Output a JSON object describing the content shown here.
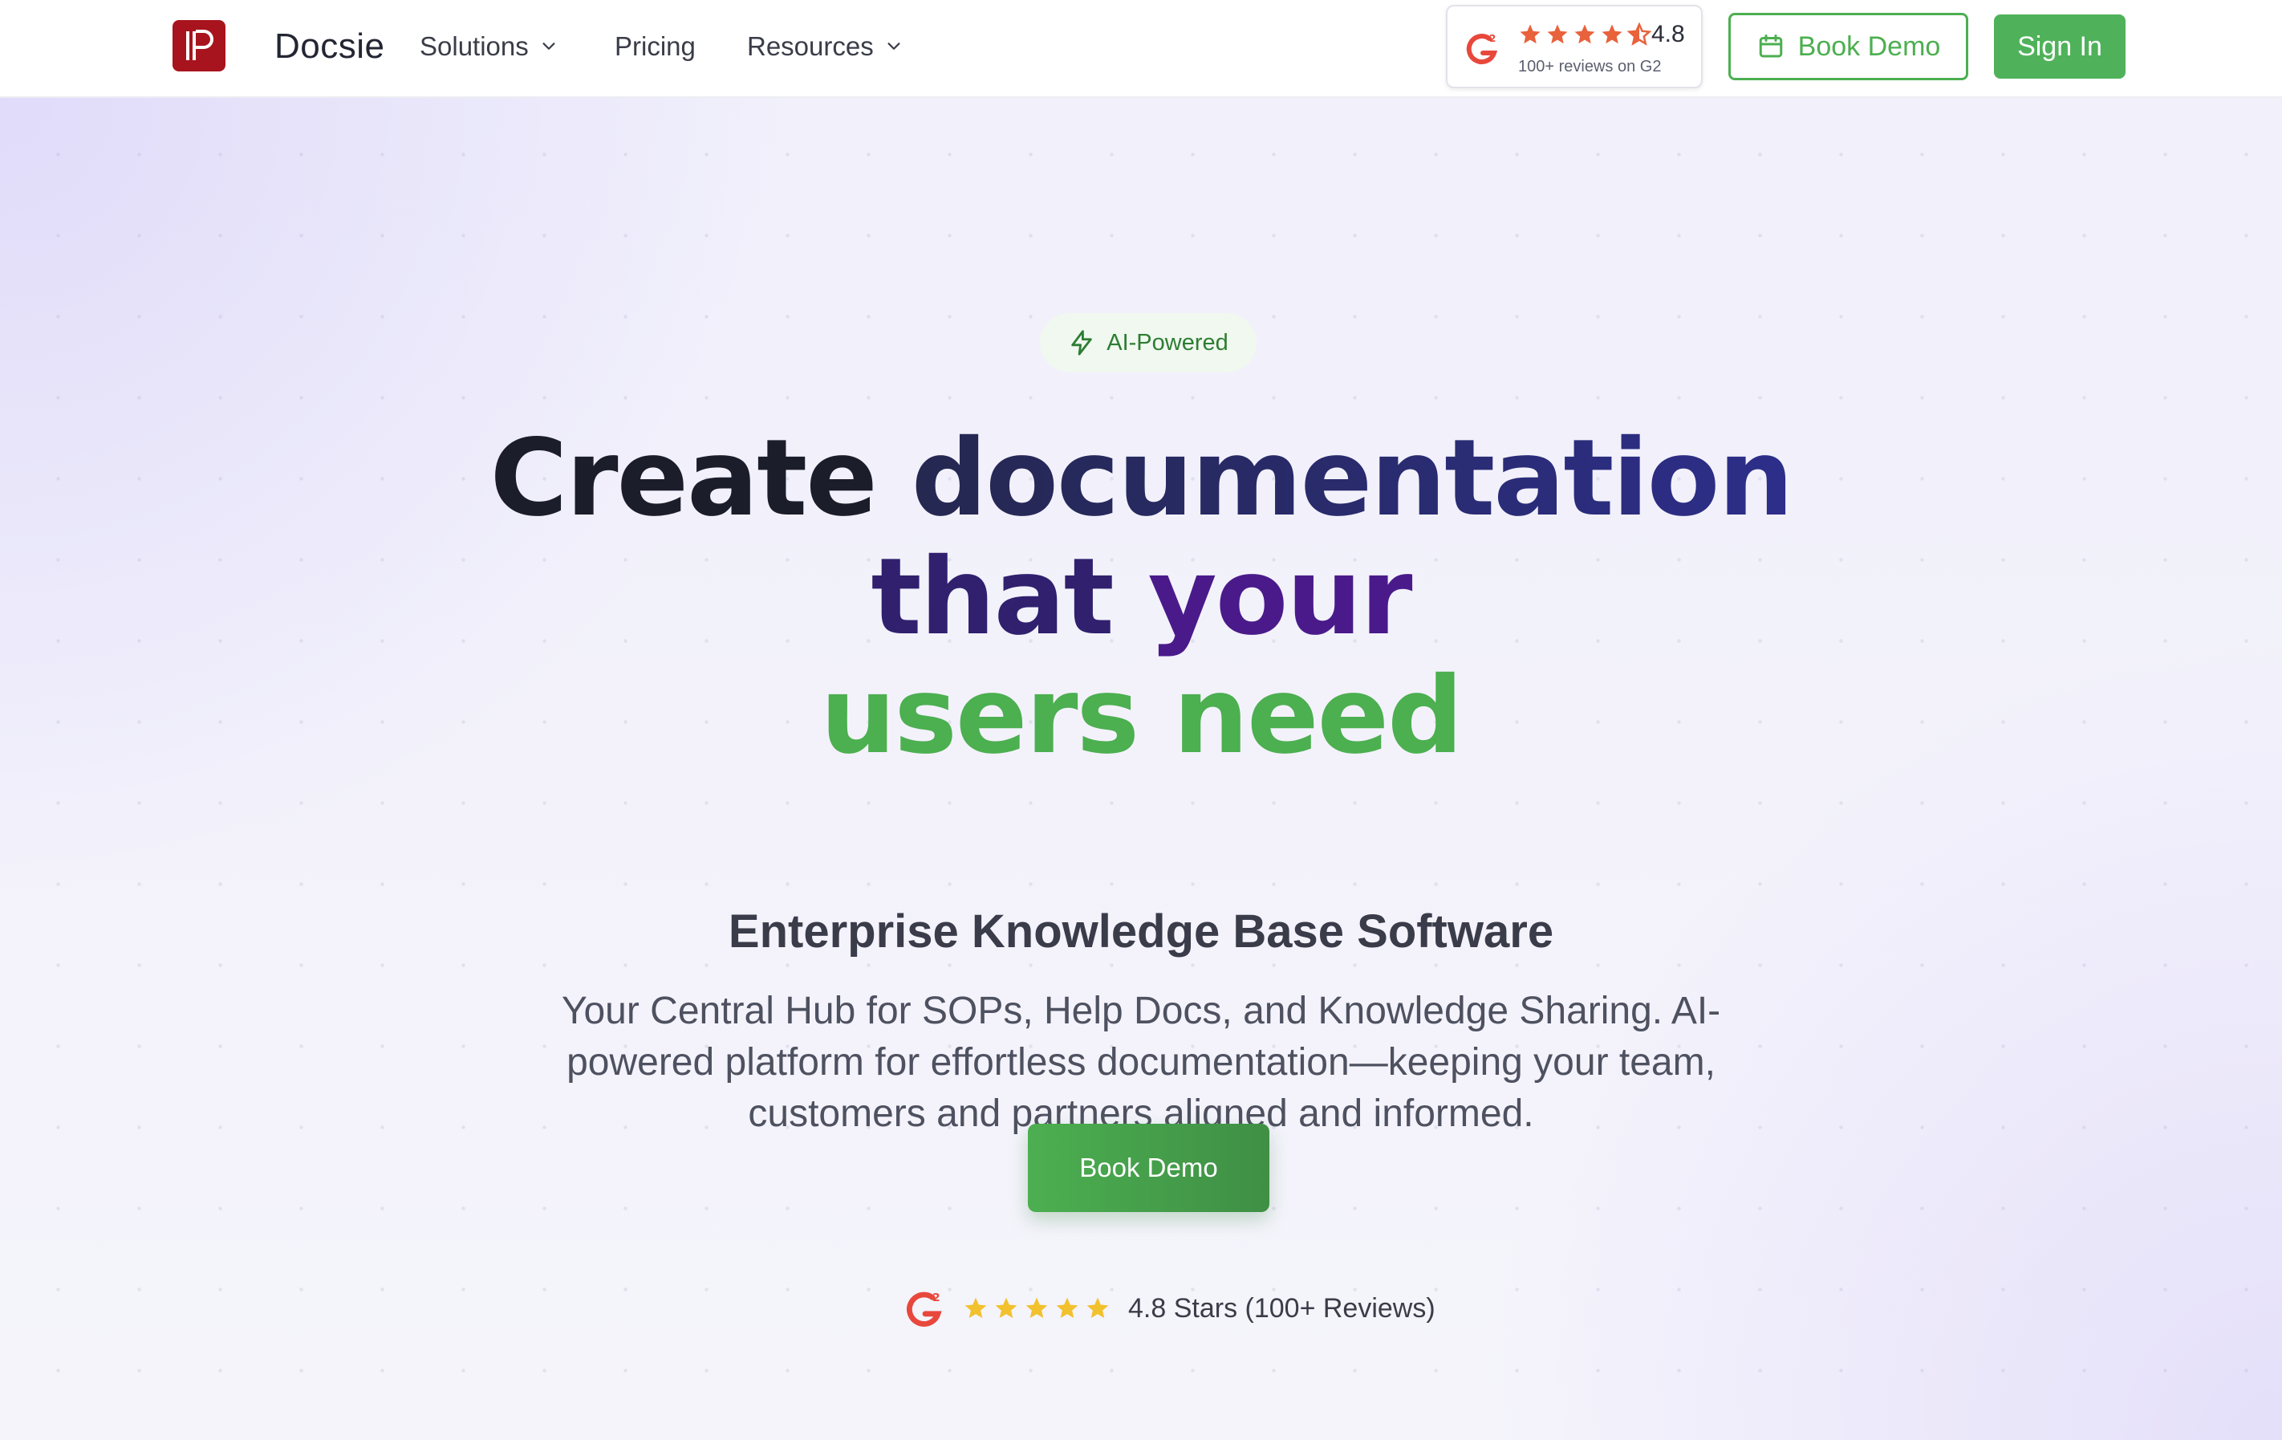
{
  "header": {
    "brand_name": "Docsie",
    "logo_glyph": "P",
    "nav": [
      {
        "label": "Solutions",
        "has_dropdown": true
      },
      {
        "label": "Pricing",
        "has_dropdown": false
      },
      {
        "label": "Resources",
        "has_dropdown": true
      }
    ],
    "g2_badge": {
      "rating": "4.8",
      "reviews": "100+ reviews on G2",
      "stars_full": 4,
      "stars_half": 1
    },
    "book_demo_label": "Book Demo",
    "sign_in_label": "Sign In"
  },
  "hero": {
    "pill_label": "AI-Powered",
    "headline": {
      "word1": "Create",
      "word2": "documentation",
      "word3": "that",
      "word4": "your",
      "line3": "users need"
    },
    "subheadline": "Enterprise Knowledge Base Software",
    "description": "Your Central Hub for SOPs, Help Docs, and Knowledge Sharing. AI-powered platform for effortless documentation—keeping your team, customers and partners aligned and informed.",
    "cta_label": "Book Demo",
    "rating_text": "4.8 Stars (100+ Reviews)",
    "rating_stars": 5
  },
  "colors": {
    "brand_red": "#a8141d",
    "accent_green": "#4caf50",
    "headline_purple": "#4a1a8a",
    "headline_indigo": "#2d2e8a",
    "g2_red": "#e8483c",
    "star_gold": "#f2c12e",
    "star_orange": "#e8623c"
  },
  "icons": [
    "chevron-down-icon",
    "g2-logo-icon",
    "star-icon",
    "calendar-icon",
    "lightning-icon"
  ]
}
